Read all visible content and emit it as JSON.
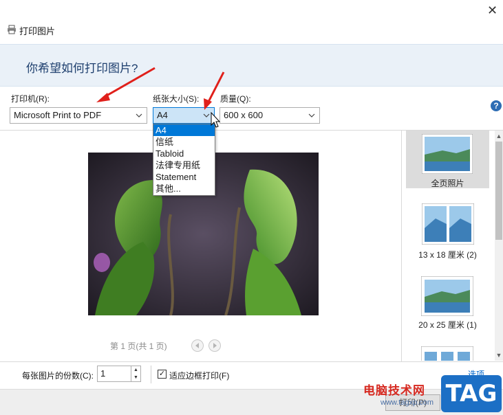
{
  "window": {
    "title": "打印图片",
    "close_glyph": "✕"
  },
  "header": {
    "question": "你希望如何打印图片?"
  },
  "toolbar": {
    "printer_label": "打印机(R):",
    "printer_value": "Microsoft Print to PDF",
    "papersize_label": "纸张大小(S):",
    "papersize_value": "A4",
    "quality_label": "质量(Q):",
    "quality_value": "600 x 600",
    "help_glyph": "?"
  },
  "papersize_dropdown": {
    "options": [
      "A4",
      "信纸",
      "Tabloid",
      "法律专用纸",
      "Statement",
      "其他..."
    ],
    "selected": "A4"
  },
  "preview": {
    "page_indicator": "第 1 页(共 1 页)"
  },
  "layouts": [
    {
      "label": "全页照片",
      "selected": true
    },
    {
      "label": "13 x 18 厘米 (2)",
      "selected": false
    },
    {
      "label": "20 x 25 厘米 (1)",
      "selected": false
    }
  ],
  "bottom": {
    "copies_label": "每张图片的份数(C):",
    "copies_value": "1",
    "fit_label": "适应边框打印(F)",
    "fit_checked": true,
    "options_link": "选项..."
  },
  "footer": {
    "print_button": "打印(P)"
  },
  "watermark": {
    "site_name": "电脑技术网",
    "url": "www.tagxp.com",
    "logo": "TAG"
  },
  "colors": {
    "accent": "#0078d7",
    "header_band": "#eaf1f8",
    "arrow": "#e0201b",
    "tag_logo": "#1c6fc5"
  }
}
